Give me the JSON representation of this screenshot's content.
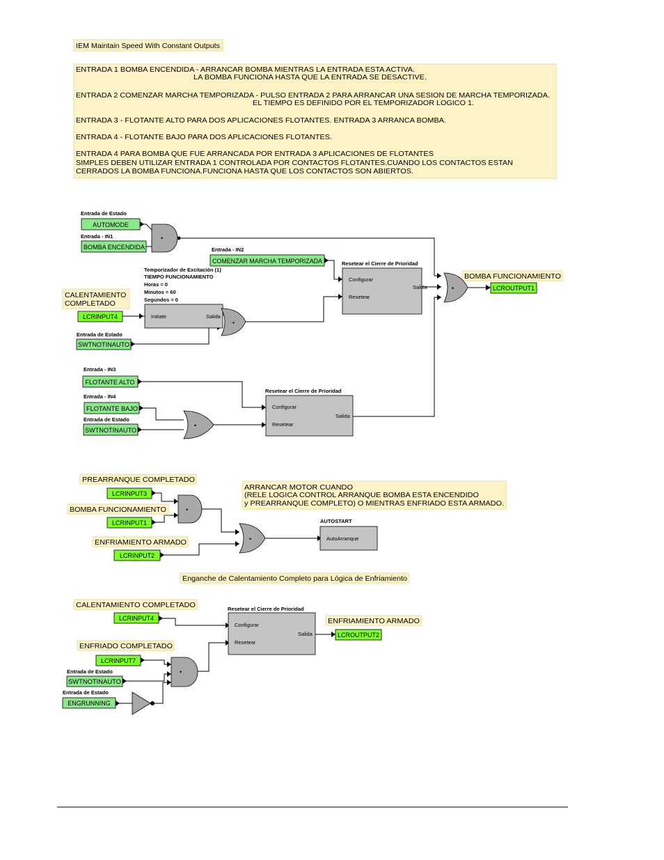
{
  "title": "IEM Maintain Speed With Constant Outputs",
  "notes": {
    "description": {
      "l1": "ENTRADA 1 BOMBA ENCENDIDA - ARRANCAR BOMBA MIENTRAS LA ENTRADA ESTA ACTIVA.",
      "l2": "LA BOMBA FUNCIONA HASTA QUE LA ENTRADA SE DESACTIVE.",
      "l3": "ENTRADA 2 COMENZAR MARCHA TEMPORIZADA - PULSO ENTRADA 2 PARA ARRANCAR UNA SESION DE MARCHA TEMPORIZADA.",
      "l4": "EL TIEMPO ES DEFINIDO POR EL TEMPORIZADOR LOGICO 1.",
      "l5": "ENTRADA 3 - FLOTANTE ALTO PARA DOS APLICACIONES FLOTANTES. ENTRADA 3 ARRANCA BOMBA.",
      "l6": "ENTRADA 4 - FLOTANTE BAJO PARA DOS APLICACIONES FLOTANTES.",
      "l7": "ENTRADA 4 PARA BOMBA QUE FUE ARRANCADA POR ENTRADA 3 APLICACIONES DE FLOTANTES",
      "l8": "SIMPLES DEBEN UTILIZAR ENTRADA 1 CONTROLADA POR CONTACTOS FLOTANTES.CUANDO LOS CONTACTOS ESTAN",
      "l9": "CERRADOS LA BOMBA FUNCIONA.FUNCIONA HASTA QUE LOS CONTACTOS SON ABIERTOS."
    },
    "autostart_note": {
      "l1": "ARRANCAR MOTOR CUANDO",
      "l2": "(RELE LOGICA CONTROL ARRANQUE BOMBA ESTA ENCENDIDO",
      "l3": "y PREARRANQUE COMPLETO) O MIENTRAS ENFRIADO ESTA ARMADO."
    },
    "latch_title": "Enganche de Calentamiento Completo para Lógica de Enfriamiento"
  },
  "labels": {
    "entrada_estado": "Entrada de Estado",
    "entrada_in1": "Entrada - IN1",
    "entrada_in2": "Entrada - IN2",
    "entrada_in3": "Entrada - IN3",
    "entrada_in4": "Entrada - IN4",
    "calentamiento_l1": "CALENTAMIENTO",
    "calentamiento_l2": "COMPLETADO",
    "bomba_funcionamiento": "BOMBA FUNCIONAMIENTO",
    "prearranque_completado": "PREARRANQUE COMPLETADO",
    "enfriamiento_armado": "ENFRIAMIENTO ARMADO",
    "calentamiento_completado": "CALENTAMIENTO COMPLETADO",
    "enfriado_completado": "ENFRIADO COMPLETADO"
  },
  "inputs": {
    "automode": "AUTOMODE",
    "bomba_encendida": "BOMBA ENCENDIDA",
    "comenzar_marcha": "COMENZAR MARCHA TEMPORIZADA",
    "lcrinput4": "LCRINPUT4",
    "swtnotinauto": "SWTNOTINAUTO",
    "flotante_alto": "FLOTANTE ALTO",
    "flotante_bajo": "FLOTANTE BAJO",
    "lcrinput3": "LCRINPUT3",
    "lcrinput1": "LCRINPUT1",
    "lcrinput2": "LCRINPUT2",
    "lcrinput7": "LCRINPUT7",
    "engrunning": "ENGRUNNING"
  },
  "outputs": {
    "lcroutput1": "LCROUTPUT1",
    "lcroutput2": "LCROUTPUT2"
  },
  "timer": {
    "title": "Temporizador de Excitación (1)",
    "name": "TIEMPO FUNCIONAMIENTO",
    "horas": "Horas = 0",
    "minutos": "Minutos = 60",
    "segundos": "Segundos = 0",
    "in_label": "Initiate",
    "out_label": "Salida"
  },
  "latch": {
    "title": "Resetear el Cierre de Prioridad",
    "set_label": "Configurar",
    "reset_label": "Resetear",
    "out_label": "Salida"
  },
  "autostart": {
    "title": "AUTOSTART",
    "in_label": "AutoArranque"
  },
  "gates": {
    "and_symbol": "•",
    "or_symbol": "+"
  },
  "colors": {
    "note_bg": "#fdf3c6",
    "input_green": "#8de88d",
    "output_green": "#7dfc2e",
    "block_gray": "#c4c4c4"
  }
}
